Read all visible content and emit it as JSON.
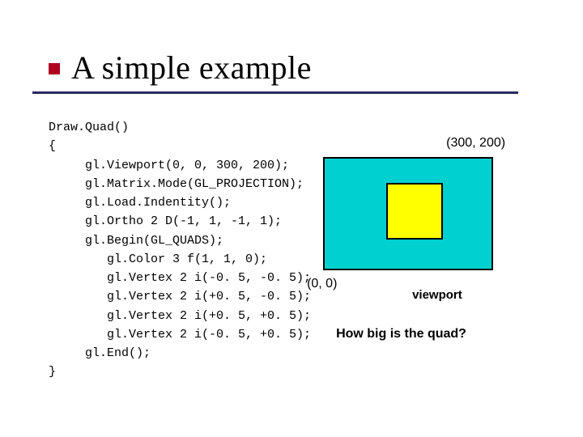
{
  "title": "A simple example",
  "code": {
    "l0": "Draw.Quad()",
    "l1": "{",
    "l2": "     gl.Viewport(0, 0, 300, 200);",
    "l3": "     gl.Matrix.Mode(GL_PROJECTION);",
    "l4": "     gl.Load.Indentity();",
    "l5": "     gl.Ortho 2 D(-1, 1, -1, 1);",
    "l6": "     gl.Begin(GL_QUADS);",
    "l7": "        gl.Color 3 f(1, 1, 0);",
    "l8": "        gl.Vertex 2 i(-0. 5, -0. 5);",
    "l9": "        gl.Vertex 2 i(+0. 5, -0. 5);",
    "l10": "        gl.Vertex 2 i(+0. 5, +0. 5);",
    "l11": "        gl.Vertex 2 i(-0. 5, +0. 5);",
    "l12": "     gl.End();",
    "l13": "}"
  },
  "diagram": {
    "coord_top_right": "(300, 200)",
    "coord_bottom_left": "(0, 0)",
    "viewport_label": "viewport",
    "question": "How  big is the quad?",
    "colors": {
      "viewport_bg": "#00d0d0",
      "quad_bg": "#ffff00"
    }
  }
}
